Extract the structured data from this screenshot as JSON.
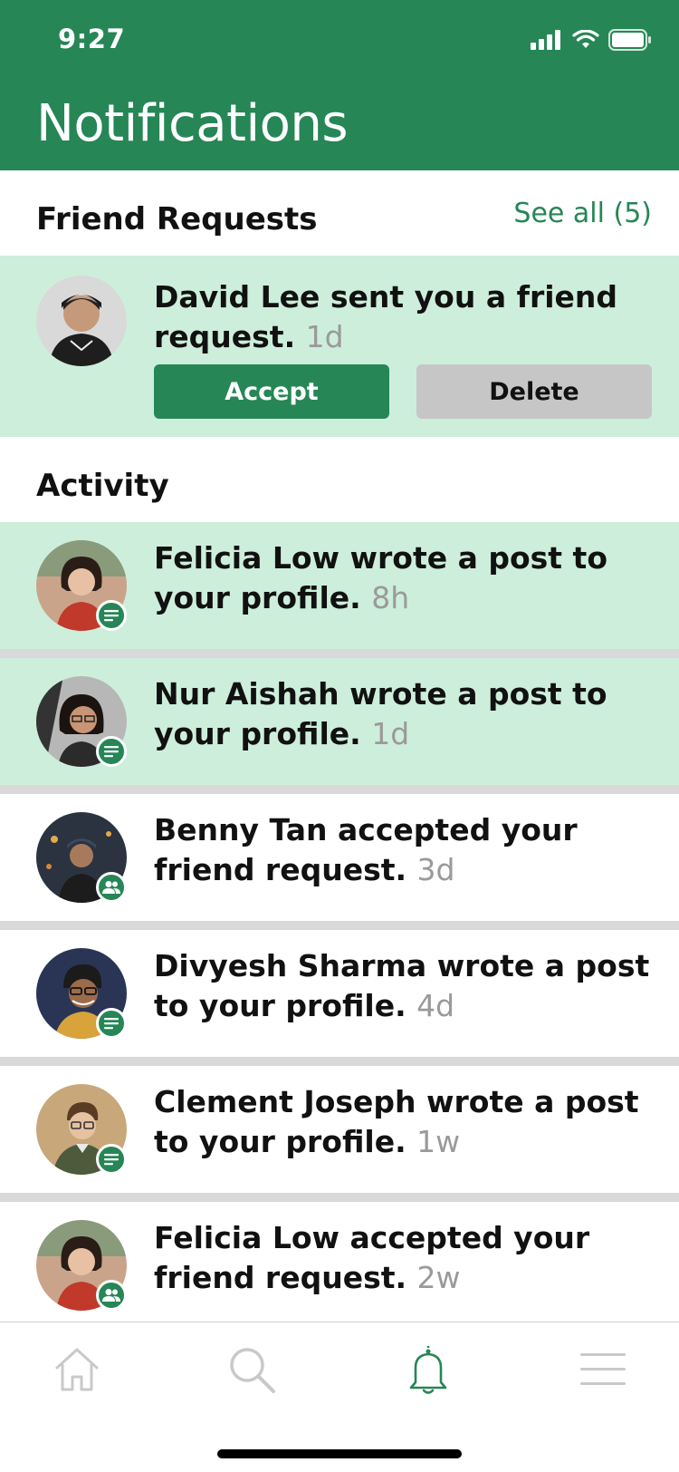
{
  "status_bar": {
    "time": "9:27"
  },
  "header": {
    "title": "Notifications"
  },
  "friend_requests": {
    "title": "Friend Requests",
    "see_all": "See all (5)",
    "request": {
      "name": "David Lee",
      "message": " sent you a friend request.",
      "time": "1d",
      "accept_label": "Accept",
      "delete_label": "Delete"
    }
  },
  "activity": {
    "title": "Activity",
    "items": [
      {
        "name": "Felicia Low",
        "message": " wrote a post to your profile.",
        "time": "8h",
        "type": "post",
        "unread": true
      },
      {
        "name": "Nur Aishah",
        "message": " wrote a post to your profile.",
        "time": "1d",
        "type": "post",
        "unread": true
      },
      {
        "name": "Benny Tan",
        "message": " accepted your friend request.",
        "time": "3d",
        "type": "friend",
        "unread": false
      },
      {
        "name": "Divyesh Sharma",
        "message": " wrote a post to your profile.",
        "time": "4d",
        "type": "post",
        "unread": false
      },
      {
        "name": "Clement Joseph",
        "message": " wrote a post to your profile.",
        "time": "1w",
        "type": "post",
        "unread": false
      },
      {
        "name": "Felicia Low",
        "message": " accepted your friend request.",
        "time": "2w",
        "type": "friend",
        "unread": false
      }
    ]
  },
  "tabbar": {
    "tabs": [
      {
        "icon": "home-icon",
        "active": false
      },
      {
        "icon": "search-icon",
        "active": false
      },
      {
        "icon": "bell-icon",
        "active": true
      },
      {
        "icon": "menu-icon",
        "active": false
      }
    ]
  },
  "colors": {
    "accent": "#268656",
    "unread_bg": "#cdeedb",
    "muted_text": "#9a9a9a",
    "delete_bg": "#c6c6c6"
  }
}
